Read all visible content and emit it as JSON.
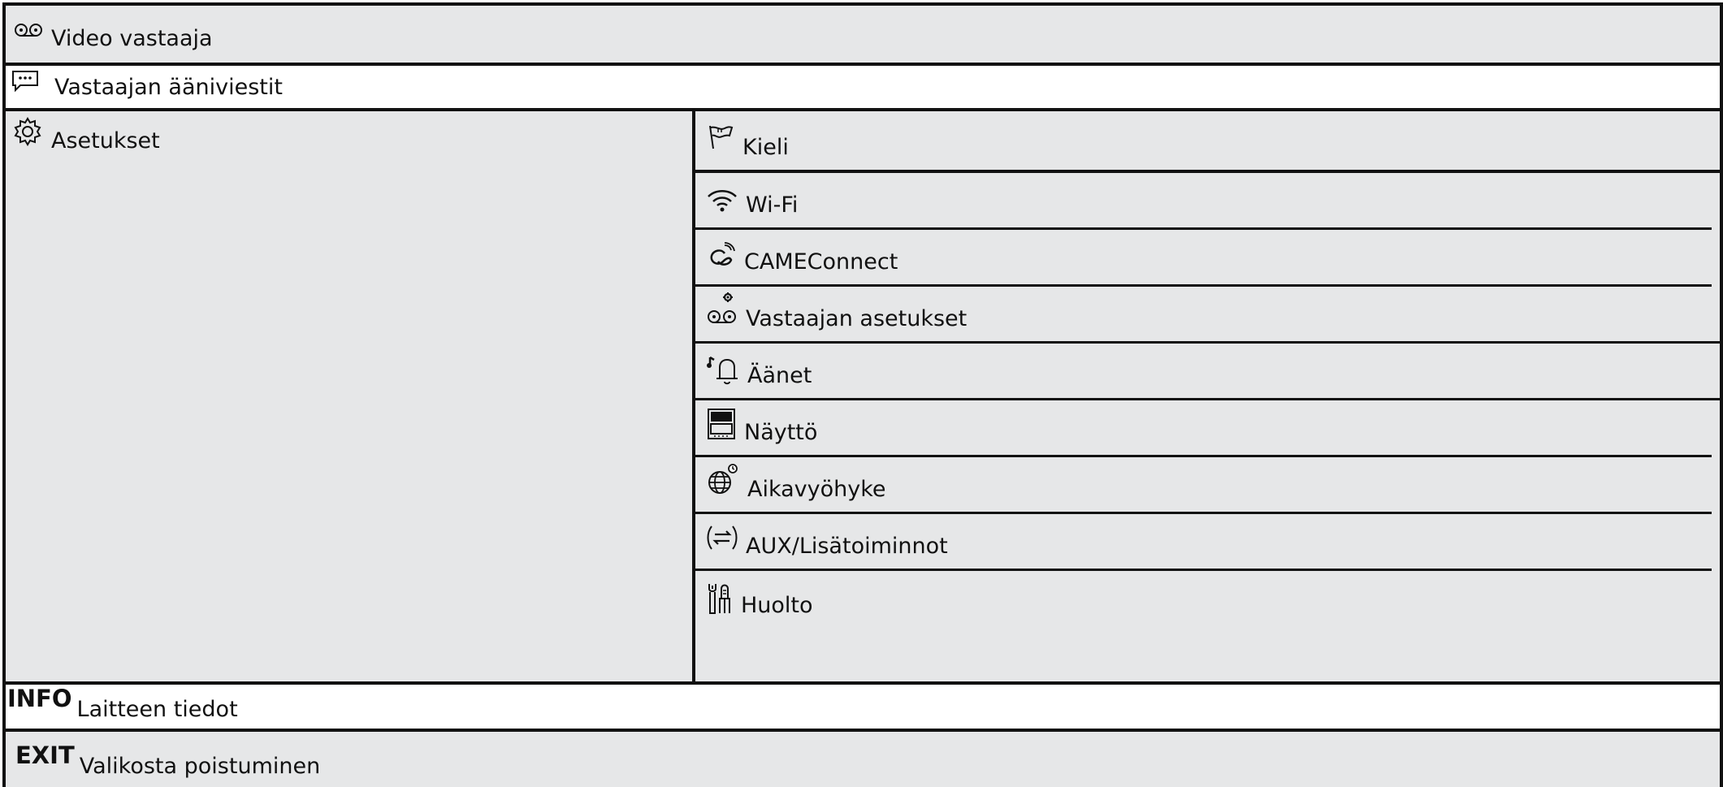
{
  "menu": {
    "video_answering": {
      "label": "Video vastaaja",
      "icon": "video-answering-icon"
    },
    "voice_messages": {
      "label": "Vastaajan ääniviestit",
      "icon": "message-icon"
    },
    "settings": {
      "label": "Asetukset",
      "icon": "gear-icon",
      "submenu": [
        {
          "label": "Kieli",
          "icon": "flag-icon"
        },
        {
          "label": "Wi-Fi",
          "icon": "wifi-icon"
        },
        {
          "label": "CAMEConnect",
          "icon": "cameconnect-icon"
        },
        {
          "label": "Vastaajan asetukset",
          "icon": "answering-settings-icon"
        },
        {
          "label": "Äänet",
          "icon": "bell-note-icon"
        },
        {
          "label": "Näyttö",
          "icon": "display-icon"
        },
        {
          "label": "Aikavyöhyke",
          "icon": "timezone-globe-icon"
        },
        {
          "label": "AUX/Lisätoiminnot",
          "icon": "aux-arrows-icon"
        },
        {
          "label": "Huolto",
          "icon": "tools-icon"
        }
      ]
    },
    "info": {
      "keyword": "INFO",
      "label": "Laitteen tiedot"
    },
    "exit": {
      "keyword": "EXIT",
      "label": "Valikosta poistuminen"
    }
  }
}
